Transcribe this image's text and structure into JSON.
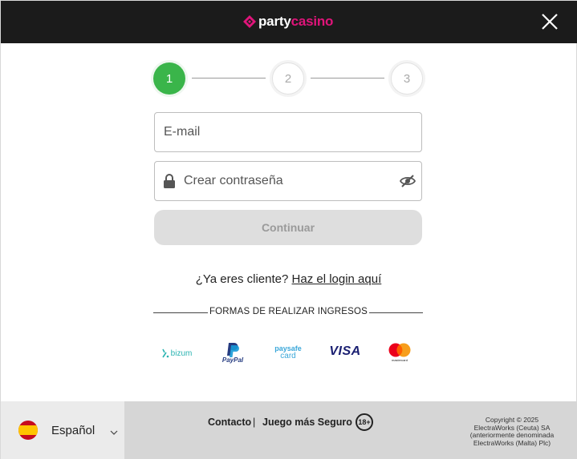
{
  "header": {
    "logo_party": "party",
    "logo_casino": "casino",
    "brand_color": "#e0147a",
    "close_icon": "close-icon"
  },
  "stepper": {
    "steps": [
      "1",
      "2",
      "3"
    ],
    "active_step": 1,
    "active_color": "#3ab54a"
  },
  "form": {
    "email_placeholder": "E-mail",
    "email_value": "",
    "password_placeholder": "Crear contraseña",
    "password_value": "",
    "password_icon": "lock-icon",
    "visibility_icon": "eye-slash-icon",
    "continue_label": "Continuar"
  },
  "login_prompt": {
    "text": "¿Ya eres cliente?",
    "link": "Haz el login aquí"
  },
  "deposit": {
    "title": "FORMAS DE REALIZAR INGRESOS",
    "methods": {
      "bizum": "bizum",
      "paypal": "PayPal",
      "paysafe_1": "paysafe",
      "paysafe_2": "card",
      "visa": "VISA",
      "mastercard": "mastercard"
    }
  },
  "footer": {
    "language": "Español",
    "contact": "Contacto",
    "separator": "|",
    "safe_play": "Juego más Seguro",
    "age_badge": "18+",
    "copyright": [
      "Copyright © 2025",
      "ElectraWorks (Ceuta) SA",
      "(anteriormente denominada",
      "ElectraWorks (Malta) Plc)"
    ]
  }
}
